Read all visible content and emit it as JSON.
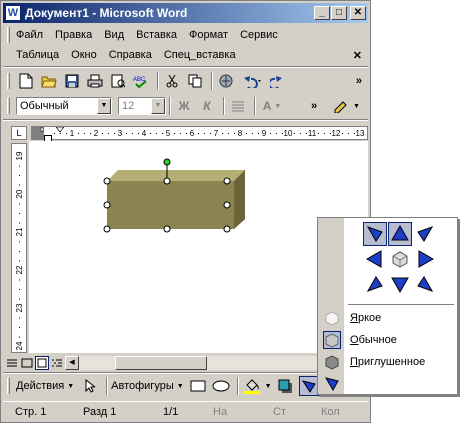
{
  "window": {
    "title": "Документ1 - Microsoft Word",
    "app_icon": "W",
    "controls": {
      "minimize": "_",
      "maximize": "□",
      "close": "✕"
    }
  },
  "menu_row1": [
    "Файл",
    "Правка",
    "Вид",
    "Вставка",
    "Формат",
    "Сервис"
  ],
  "menu_row2": [
    "Таблица",
    "Окно",
    "Справка",
    "Спец_вставка"
  ],
  "menu_close": "✕",
  "formatting": {
    "style": "Обычный",
    "size": "12",
    "bold": "Ж",
    "italic": "К",
    "font_color_glyph": "A"
  },
  "ruler": {
    "h_numbers": [
      "1",
      "2",
      "3",
      "4",
      "5",
      "6",
      "7",
      "8",
      "9",
      "10",
      "11",
      "12",
      "13"
    ],
    "v_numbers": [
      "19",
      "20",
      "21",
      "22",
      "23",
      "24"
    ]
  },
  "drawing_toolbar": {
    "actions": "Действия",
    "autoshapes": "Автофигуры"
  },
  "statusbar": {
    "page": "Стр. 1",
    "section": "Разд 1",
    "pages": "1/1",
    "at": "На",
    "line": "Ст",
    "col": "Кол"
  },
  "lighting_popup": {
    "options": [
      "Яркое",
      "Обычное",
      "Приглушенное"
    ],
    "selected_option": "Обычное",
    "underline_letters": [
      "Я",
      "О",
      "П"
    ]
  },
  "colors": {
    "shape_face": "#8b8450",
    "shape_top": "#b4af74",
    "shape_side": "#6b6538",
    "title_gradient_start": "#0a246a",
    "selection": "#b6bdd2"
  }
}
